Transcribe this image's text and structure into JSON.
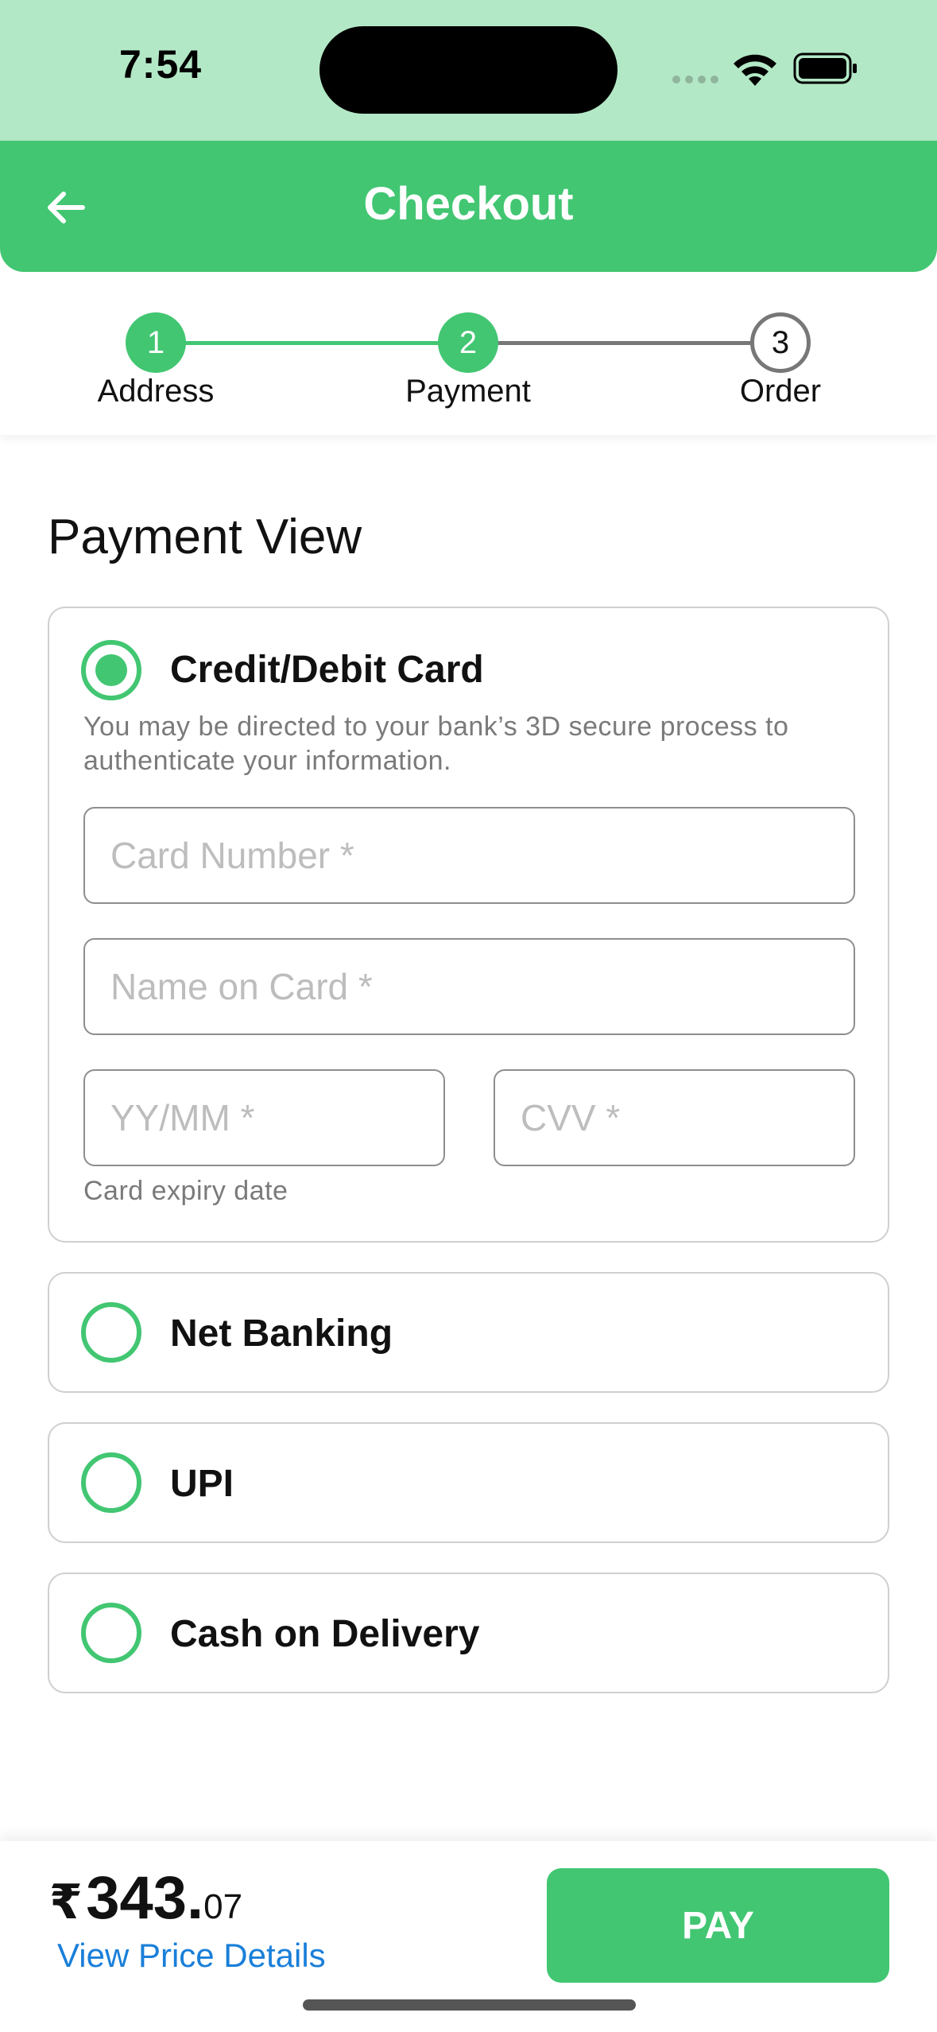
{
  "status_bar": {
    "time": "7:54"
  },
  "header": {
    "title": "Checkout",
    "back_icon": "arrow-left-icon"
  },
  "stepper": {
    "steps": [
      {
        "number": "1",
        "label": "Address",
        "state": "completed"
      },
      {
        "number": "2",
        "label": "Payment",
        "state": "current"
      },
      {
        "number": "3",
        "label": "Order",
        "state": "pending"
      }
    ]
  },
  "payment": {
    "title": "Payment View",
    "options": [
      {
        "label": "Credit/Debit Card",
        "selected": true
      },
      {
        "label": "Net Banking",
        "selected": false
      },
      {
        "label": "UPI",
        "selected": false
      },
      {
        "label": "Cash on Delivery",
        "selected": false
      }
    ],
    "card": {
      "note": "You may be directed to your bank’s 3D secure process to authenticate your information.",
      "card_number_placeholder": "Card Number *",
      "name_placeholder": "Name on Card *",
      "expiry_placeholder": "YY/MM *",
      "cvv_placeholder": "CVV *",
      "expiry_helper": "Card expiry date"
    }
  },
  "footer": {
    "currency": "₹",
    "amount_whole": "343.",
    "amount_decimal": "07",
    "view_details": "View Price Details",
    "pay_label": "PAY"
  },
  "colors": {
    "accent": "#42c672",
    "status_bar_bg": "#b3e8c6",
    "link": "#1a7fd9",
    "inactive": "#777777"
  }
}
